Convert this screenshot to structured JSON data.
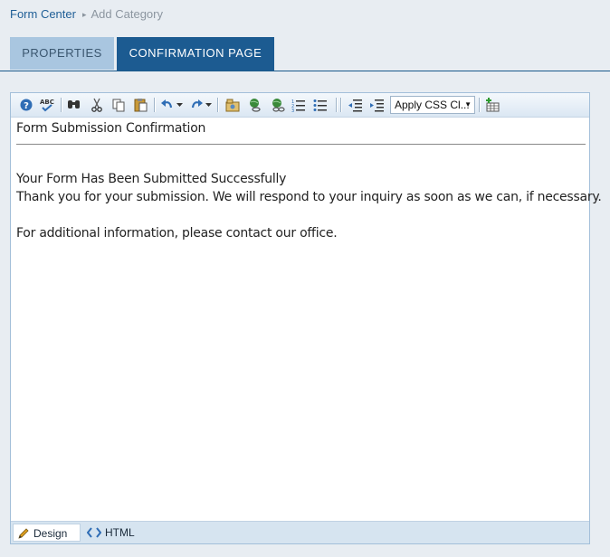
{
  "breadcrumb": {
    "root": "Form Center",
    "separator": "▸",
    "current": "Add Category"
  },
  "tabs": [
    {
      "label": "PROPERTIES",
      "active": false
    },
    {
      "label": "CONFIRMATION PAGE",
      "active": true
    }
  ],
  "toolbar": {
    "icons": [
      "help-icon",
      "spellcheck-icon",
      "find-icon",
      "cut-icon",
      "copy-icon",
      "paste-icon",
      "undo-icon",
      "redo-icon",
      "image-manager-icon",
      "hyperlink-icon",
      "remove-link-icon",
      "numbered-list-icon",
      "bulleted-list-icon",
      "outdent-icon",
      "indent-icon",
      "insert-table-icon"
    ],
    "css_select": "Apply CSS Cl..."
  },
  "content": {
    "heading": "Form Submission Confirmation",
    "line1": "Your Form Has Been Submitted Successfully",
    "line2": "Thank you for your submission. We will respond to your inquiry as soon as we can, if necessary.",
    "line3": "For additional information, please contact our office."
  },
  "modes": {
    "design": "Design",
    "html": "HTML"
  },
  "colors": {
    "accent": "#1c5b91",
    "tab_inactive": "#a9c6e0",
    "link": "#1e5e96"
  }
}
